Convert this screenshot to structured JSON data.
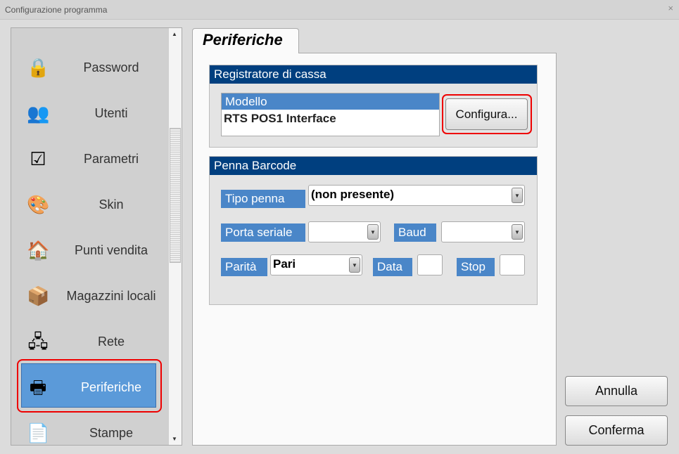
{
  "window": {
    "title": "Configurazione programma",
    "close": "×"
  },
  "sidebar": {
    "items": [
      {
        "label": "Password",
        "icon": "lock-icon",
        "glyph": "🔒"
      },
      {
        "label": "Utenti",
        "icon": "users-icon",
        "glyph": "👥"
      },
      {
        "label": "Parametri",
        "icon": "parameters-icon",
        "glyph": "☑"
      },
      {
        "label": "Skin",
        "icon": "palette-icon",
        "glyph": "🎨"
      },
      {
        "label": "Punti vendita",
        "icon": "store-add-icon",
        "glyph": "🏠"
      },
      {
        "label": "Magazzini locali",
        "icon": "warehouse-add-icon",
        "glyph": "📦"
      },
      {
        "label": "Rete",
        "icon": "network-icon",
        "glyph": "🖧"
      },
      {
        "label": "Periferiche",
        "icon": "cash-register-icon",
        "glyph": "🖶",
        "selected": true
      },
      {
        "label": "Stampe",
        "icon": "print-settings-icon",
        "glyph": "📄"
      }
    ]
  },
  "tab": {
    "label": "Periferiche"
  },
  "registratore": {
    "header": "Registratore di cassa",
    "list_header": "Modello",
    "list_value": "RTS POS1 Interface",
    "configure": "Configura..."
  },
  "barcode": {
    "header": "Penna Barcode",
    "tipo_label": "Tipo penna",
    "tipo_value": "(non presente)",
    "porta_label": "Porta seriale",
    "porta_value": "",
    "baud_label": "Baud",
    "baud_value": "",
    "parita_label": "Parità",
    "parita_value": "Pari",
    "data_label": "Data",
    "data_value": "",
    "stop_label": "Stop",
    "stop_value": ""
  },
  "buttons": {
    "cancel": "Annulla",
    "confirm": "Conferma"
  }
}
